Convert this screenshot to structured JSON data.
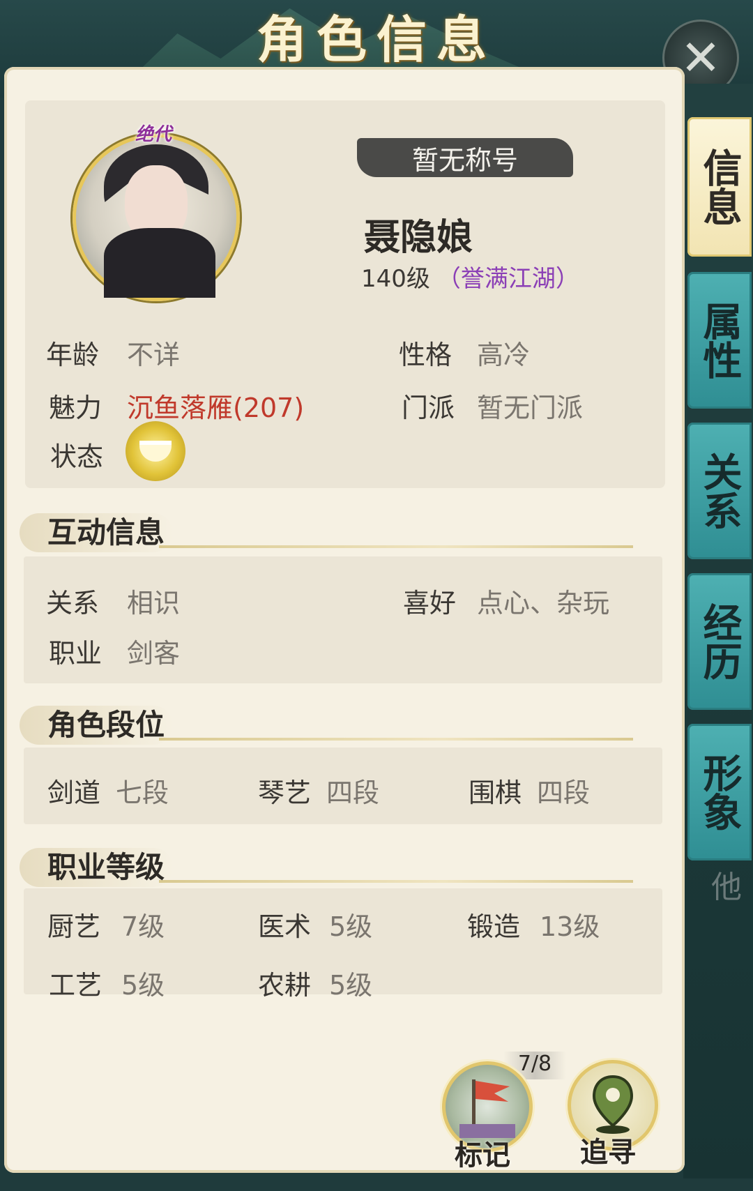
{
  "header": {
    "title": "角色信息"
  },
  "character": {
    "badge": "绝代",
    "title_banner": "暂无称号",
    "name": "聂隐娘",
    "level": "140级",
    "rank": "（誉满江湖）"
  },
  "basic": {
    "age_label": "年龄",
    "age_value": "不详",
    "personality_label": "性格",
    "personality_value": "高冷",
    "charm_label": "魅力",
    "charm_value": "沉鱼落雁(207)",
    "sect_label": "门派",
    "sect_value": "暂无门派",
    "status_label": "状态"
  },
  "interaction": {
    "header": "互动信息",
    "relation_label": "关系",
    "relation_value": "相识",
    "hobby_label": "喜好",
    "hobby_value": "点心、杂玩",
    "job_label": "职业",
    "job_value": "剑客"
  },
  "ranks": {
    "header": "角色段位",
    "items": [
      {
        "label": "剑道",
        "value": "七段"
      },
      {
        "label": "琴艺",
        "value": "四段"
      },
      {
        "label": "围棋",
        "value": "四段"
      }
    ]
  },
  "job_levels": {
    "header": "职业等级",
    "items": [
      {
        "label": "厨艺",
        "value": "7级"
      },
      {
        "label": "医术",
        "value": "5级"
      },
      {
        "label": "锻造",
        "value": "13级"
      },
      {
        "label": "工艺",
        "value": "5级"
      },
      {
        "label": "农耕",
        "value": "5级"
      }
    ]
  },
  "side_tabs": [
    {
      "label": "信息",
      "active": true
    },
    {
      "label": "属性",
      "active": false
    },
    {
      "label": "关系",
      "active": false
    },
    {
      "label": "经历",
      "active": false
    },
    {
      "label": "形象",
      "active": false
    }
  ],
  "side_tab_partial": "他",
  "actions": {
    "mark_label": "标记",
    "mark_count": "7/8",
    "track_label": "追寻"
  },
  "colors": {
    "accent_gold": "#e1c66c",
    "tab_teal": "#3fa0a3",
    "charm_red": "#c0392b",
    "rank_purple": "#8b3fb6"
  }
}
